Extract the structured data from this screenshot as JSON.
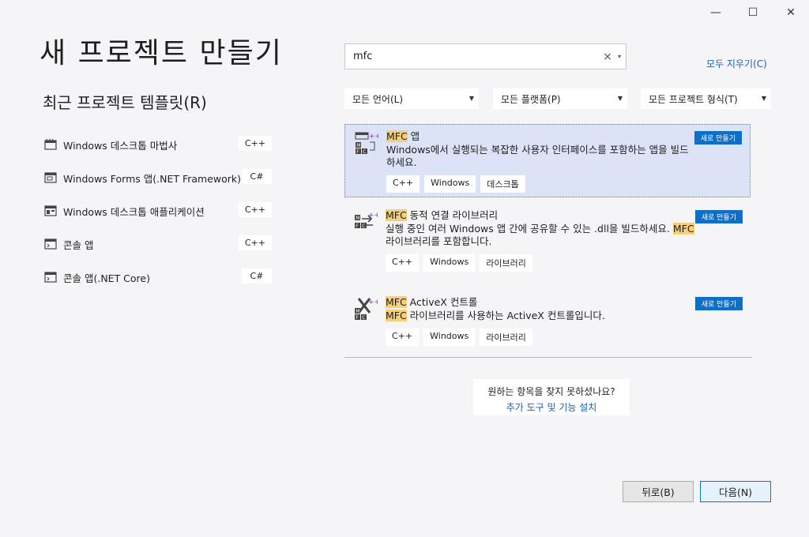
{
  "window": {
    "minimize": "—",
    "maximize": "☐",
    "close": "✕"
  },
  "page_title": "새 프로젝트 만들기",
  "recent": {
    "title": "최근 프로젝트 템플릿(R)",
    "items": [
      {
        "label": "Windows 데스크톱 마법사",
        "lang": "C++",
        "icon": "wizard-icon"
      },
      {
        "label": "Windows Forms 앱(.NET Framework)",
        "lang": "C#",
        "icon": "forms-app-icon"
      },
      {
        "label": "Windows 데스크톱 애플리케이션",
        "lang": "C++",
        "icon": "desktop-app-icon"
      },
      {
        "label": "콘솔 앱",
        "lang": "C++",
        "icon": "console-icon"
      },
      {
        "label": "콘솔 앱(.NET Core)",
        "lang": "C#",
        "icon": "console-icon"
      }
    ]
  },
  "search": {
    "value": "mfc",
    "clear": "×",
    "dropdown": "▾"
  },
  "clear_all": "모두 지우기(C)",
  "filters": {
    "language": "모든 언어(L)",
    "platform": "모든 플랫폼(P)",
    "project_type": "모든 프로젝트 형식(T)",
    "caret": "▼"
  },
  "results": [
    {
      "title_hl": "MFC",
      "title_rest": " 앱",
      "desc_hl": "",
      "desc": "Windows에서 실행되는 복잡한 사용자 인터페이스를 포함하는 앱을 빌드하세요.",
      "desc_hl2": "",
      "desc_tail": "",
      "tags": [
        "C++",
        "Windows",
        "데스크톱"
      ],
      "new_label": "새로 만들기",
      "selected": true
    },
    {
      "title_hl": "MFC",
      "title_rest": " 동적 연결 라이브러리",
      "desc_hl": "",
      "desc": "실행 중인 여러 Windows 앱 간에 공유할 수 있는 .dll을 빌드하세요. ",
      "desc_hl2": "MFC",
      "desc_tail": " 라이브러리를 포함합니다.",
      "tags": [
        "C++",
        "Windows",
        "라이브러리"
      ],
      "new_label": "새로 만들기",
      "selected": false
    },
    {
      "title_hl": "MFC",
      "title_rest": " ActiveX 컨트롤",
      "desc_hl": "MFC",
      "desc": " 라이브러리를 사용하는 ActiveX 컨트롤입니다.",
      "desc_hl2": "",
      "desc_tail": "",
      "tags": [
        "C++",
        "Windows",
        "라이브러리"
      ],
      "new_label": "새로 만들기",
      "selected": false
    }
  ],
  "not_found": {
    "question": "원하는 항목을 찾지 못하셨나요?",
    "link": "추가 도구 및 기능 설치"
  },
  "buttons": {
    "back": "뒤로(B)",
    "next": "다음(N)"
  },
  "colors": {
    "accent": "#0f6fc6",
    "highlight": "#f5cf7a",
    "selected_bg": "#dde3f7",
    "link": "#1a5fb4"
  }
}
